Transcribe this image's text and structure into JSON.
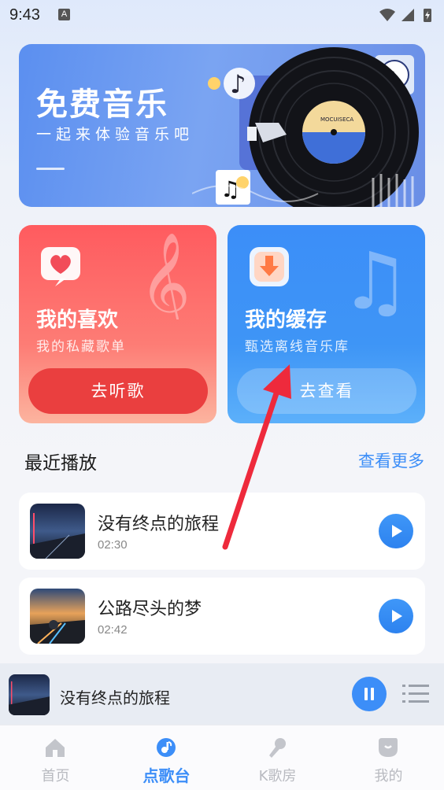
{
  "status_bar": {
    "time": "9:43",
    "badge": "A"
  },
  "banner": {
    "title": "免费音乐",
    "subtitle": "一起来体验音乐吧"
  },
  "cards": {
    "favorites": {
      "title": "我的喜欢",
      "subtitle": "我的私藏歌单",
      "button": "去听歌",
      "icon": "heart-icon"
    },
    "cache": {
      "title": "我的缓存",
      "subtitle": "甄选离线音乐库",
      "button": "去查看",
      "icon": "download-icon"
    }
  },
  "recent": {
    "title": "最近播放",
    "more": "查看更多",
    "songs": [
      {
        "name": "没有终点的旅程",
        "duration": "02:30"
      },
      {
        "name": "公路尽头的梦",
        "duration": "02:42"
      }
    ]
  },
  "mini_player": {
    "song": "没有终点的旅程"
  },
  "tabs": [
    {
      "label": "首页",
      "icon": "home-icon",
      "active": false
    },
    {
      "label": "点歌台",
      "icon": "music-note-icon",
      "active": true
    },
    {
      "label": "K歌房",
      "icon": "microphone-icon",
      "active": false
    },
    {
      "label": "我的",
      "icon": "profile-icon",
      "active": false
    }
  ],
  "colors": {
    "accent": "#3c8ef8",
    "fav_red": "#ff5b5f",
    "annotation_red": "#ee2a3c"
  }
}
